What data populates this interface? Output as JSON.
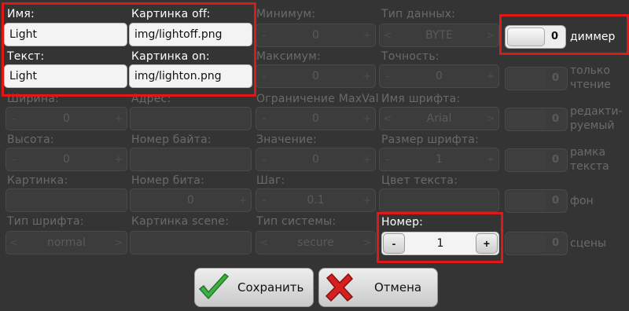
{
  "col1": {
    "name_label": "Имя:",
    "name_value": "Light",
    "text_label": "Текст:",
    "text_value": "Light",
    "width_label": "Ширина:",
    "width_value": "0",
    "height_label": "Высота:",
    "height_value": "0",
    "image_label": "Картинка:",
    "image_value": "",
    "font_type_label": "Тип шрифта:",
    "font_type_value": "normal"
  },
  "col2": {
    "img_off_label": "Картинка off:",
    "img_off_value": "img/lightoff.png",
    "img_on_label": "Картинка on:",
    "img_on_value": "img/lighton.png",
    "address_label": "Адрес:",
    "address_value": "",
    "byte_label": "Номер байта:",
    "byte_value": "",
    "bit_label": "Номер бита:",
    "bit_value": "0",
    "scene_img_label": "Картинка scene:",
    "scene_img_value": ""
  },
  "col3": {
    "min_label": "Минимум:",
    "min_value": "0",
    "max_label": "Максимум:",
    "max_value": "0",
    "maxval_label": "Ограничение MaxVal",
    "maxval_value": "0",
    "value_label": "Значение:",
    "value_value": "0",
    "step_label": "Шаг:",
    "step_value": "0.1",
    "system_label": "Тип системы:",
    "system_value": "secure"
  },
  "col4": {
    "datatype_label": "Тип данных:",
    "datatype_value": "BYTE",
    "precision_label": "Точность:",
    "precision_value": "0",
    "font_label": "Имя шрифта:",
    "font_value": "Arial",
    "font_size_label": "Размер шрифта:",
    "font_size_value": "1",
    "text_color_label": "Цвет текста:",
    "text_color_value": "",
    "number_label": "Номер:",
    "number_value": "1"
  },
  "spin": {
    "minus": "-",
    "plus": "+",
    "left": "<",
    "right": ">"
  },
  "checkboxes": [
    {
      "num": "0",
      "label": "диммер"
    },
    {
      "num": "0",
      "label": "только чтение"
    },
    {
      "num": "0",
      "label": "редакти-руемый"
    },
    {
      "num": "0",
      "label": "рамка текста"
    },
    {
      "num": "0",
      "label": "фон"
    },
    {
      "num": "0",
      "label": "сцены"
    }
  ],
  "buttons": {
    "save": "Сохранить",
    "cancel": "Отмена"
  },
  "colors": {
    "highlight": "#e01818",
    "accept": "#3cb043",
    "reject": "#d42020"
  }
}
